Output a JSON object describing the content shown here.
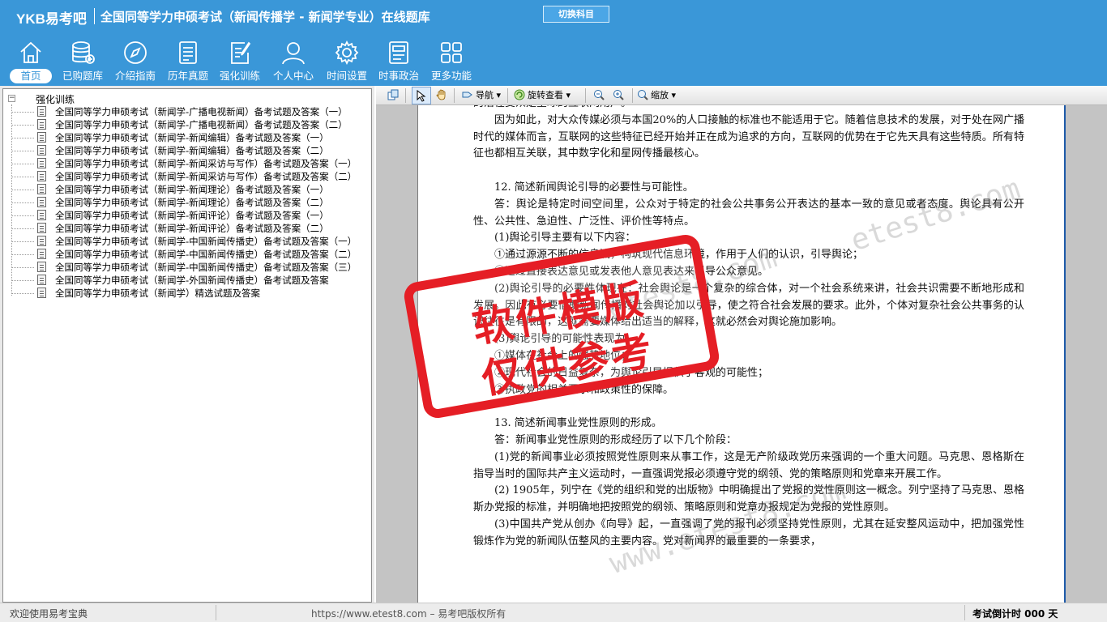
{
  "header": {
    "logo": "YKB易考吧",
    "title": "全国同等学力申硕考试（新闻传播学 - 新闻学专业）在线题库",
    "switch_button": "切换科目"
  },
  "nav": [
    {
      "label": "首页",
      "icon": "home-icon",
      "active": true
    },
    {
      "label": "已购题库",
      "icon": "database-icon"
    },
    {
      "label": "介绍指南",
      "icon": "compass-icon"
    },
    {
      "label": "历年真题",
      "icon": "document-list-icon"
    },
    {
      "label": "强化训练",
      "icon": "edit-icon"
    },
    {
      "label": "个人中心",
      "icon": "user-icon"
    },
    {
      "label": "时间设置",
      "icon": "gear-icon"
    },
    {
      "label": "时事政治",
      "icon": "news-icon"
    },
    {
      "label": "更多功能",
      "icon": "grid-icon"
    }
  ],
  "tree": {
    "root": "强化训练",
    "items": [
      "全国同等学力申硕考试（新闻学-广播电视新闻）备考试题及答案（一）",
      "全国同等学力申硕考试（新闻学-广播电视新闻）备考试题及答案（二）",
      "全国同等学力申硕考试（新闻学-新闻编辑）备考试题及答案（一）",
      "全国同等学力申硕考试（新闻学-新闻编辑）备考试题及答案（二）",
      "全国同等学力申硕考试（新闻学-新闻采访与写作）备考试题及答案（一）",
      "全国同等学力申硕考试（新闻学-新闻采访与写作）备考试题及答案（二）",
      "全国同等学力申硕考试（新闻学-新闻理论）备考试题及答案（一）",
      "全国同等学力申硕考试（新闻学-新闻理论）备考试题及答案（二）",
      "全国同等学力申硕考试（新闻学-新闻评论）备考试题及答案（一）",
      "全国同等学力申硕考试（新闻学-新闻评论）备考试题及答案（二）",
      "全国同等学力申硕考试（新闻学-中国新闻传播史）备考试题及答案（一）",
      "全国同等学力申硕考试（新闻学-中国新闻传播史）备考试题及答案（二）",
      "全国同等学力申硕考试（新闻学-中国新闻传播史）备考试题及答案（三）",
      "全国同等学力申硕考试（新闻学-外国新闻传播史）备考试题及答案",
      "全国同等学力申硕考试（新闻学）精选试题及答案"
    ]
  },
  "toolbar": {
    "navigate": "导航",
    "rotate": "旋转查看",
    "zoom": "缩放"
  },
  "document": {
    "paragraphs": [
      {
        "text": "的潜在受众是全球的互联网用户。",
        "style": ""
      },
      {
        "text": "因为如此，对大众传媒必须与本国20%的人口接触的标准也不能适用于它。随着信息技术的发展，对于处在网广播时代的媒体而言，互联网的这些特征已经开始并正在成为追求的方向，互联网的优势在于它先天具有这些特质。所有特征也都相互关联，其中数字化和星网传播最核心。",
        "style": "indent"
      },
      {
        "text": "12. 简述新闻舆论引导的必要性与可能性。",
        "style": "indent gap"
      },
      {
        "text": "答：舆论是特定时间空间里，公众对于特定的社会公共事务公开表达的基本一致的意见或者态度。舆论具有公开性、公共性、急迫性、广泛性、评价性等特点。",
        "style": "indent"
      },
      {
        "text": "(1)舆论引导主要有以下内容：",
        "style": "indent"
      },
      {
        "text": "①通过源源不断的信息流，构筑现代信息环境，作用于人们的认识，引导舆论；",
        "style": "indent"
      },
      {
        "text": "②通过直接表达意见或发表他人意见表达来引导公众意见。",
        "style": "indent"
      },
      {
        "text": "(2)舆论引导的必要性体现在：社会舆论是一个复杂的综合体，对一个社会系统来讲，社会共识需要不断地形成和发展。因此有必要借助新闻传播对社会舆论加以引导，使之符合社会发展的要求。此外，个体对复杂社会公共事务的认识往往是有限的，这就需要媒体给出适当的解释，这就必然会对舆论施加影响。",
        "style": "indent"
      },
      {
        "text": "(3)舆论引导的可能性表现为：",
        "style": "indent"
      },
      {
        "text": "①媒体在社会上的强势地位；",
        "style": "indent"
      },
      {
        "text": "②现代社会的日益复杂，为舆论引导提供了客观的可能性；",
        "style": "indent"
      },
      {
        "text": "③执政党的相关要求和政策性的保障。",
        "style": "indent"
      },
      {
        "text": "13. 简述新闻事业党性原则的形成。",
        "style": "indent gap"
      },
      {
        "text": "答：新闻事业党性原则的形成经历了以下几个阶段：",
        "style": "indent"
      },
      {
        "text": "(1)党的新闻事业必须按照党性原则来从事工作，这是无产阶级政党历来强调的一个重大问题。马克思、恩格斯在指导当时的国际共产主义运动时，一直强调党报必须遵守党的纲领、党的策略原则和党章来开展工作。",
        "style": "indent"
      },
      {
        "text": "(2) 1905年，列宁在《党的组织和党的出版物》中明确提出了党报的党性原则这一概念。列宁坚持了马克思、恩格斯办党报的标准，并明确地把按照党的纲领、策略原则和党章办报规定为党报的党性原则。",
        "style": "indent"
      },
      {
        "text": "(3)中国共产党从创办《向导》起，一直强调了党的报刊必须坚持党性原则，尤其在延安整风运动中，把加强党性锻炼作为党的新闻队伍整风的主要内容。党对新闻界的最重要的一条要求，",
        "style": "indent"
      }
    ],
    "watermarks": [
      "etest8.com",
      "www.etest8.com"
    ]
  },
  "stamp": {
    "line1": "软件模版",
    "line2": "仅供参考",
    "color": "#e51e25"
  },
  "status": {
    "welcome": "欢迎使用易考宝典",
    "copyright": "https://www.etest8.com – 易考吧版权所有",
    "countdown": "考试倒计时 000 天"
  },
  "colors": {
    "header_bg": "#3a97d8",
    "stamp_red": "#e51e25"
  }
}
